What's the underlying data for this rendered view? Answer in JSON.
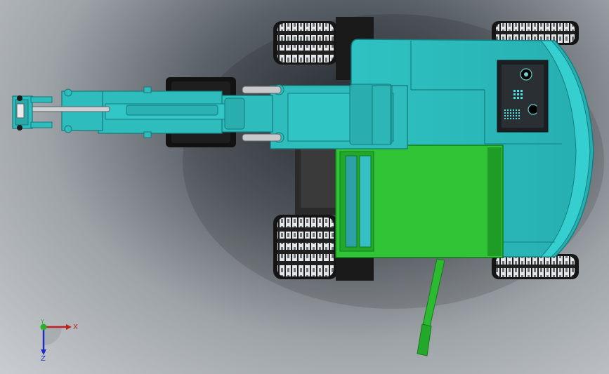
{
  "viewport": {
    "background_center": "#2c3238",
    "background_edge": "#c9cdd1"
  },
  "model": {
    "cab_color": "#2fc0c0",
    "cab_shade": "#24a5a6",
    "counterweight_color": "#2ec534",
    "counterweight_shade": "#1e9f26",
    "track_color": "#1a1a1a",
    "boom_color": "#2fbcbc"
  },
  "triad": {
    "x_label": "X",
    "y_label": "Y",
    "z_label": "Z",
    "x_color": "#c21f1f",
    "y_color": "#28b028",
    "z_color": "#1f2ec2"
  }
}
